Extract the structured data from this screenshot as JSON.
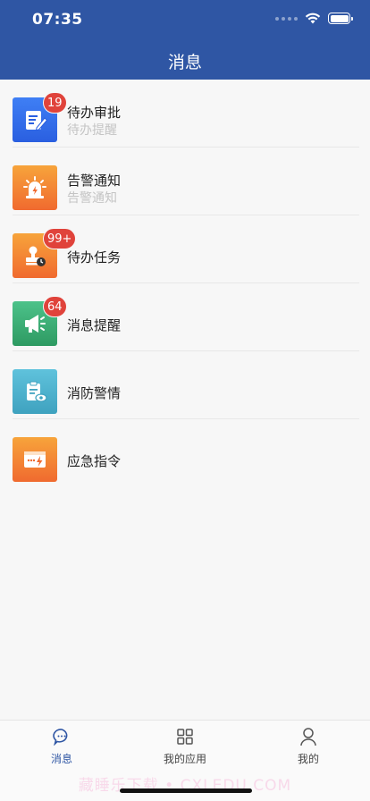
{
  "status_bar": {
    "time": "07:35"
  },
  "header": {
    "title": "消息"
  },
  "list": [
    {
      "title": "待办审批",
      "subtitle": "待办提醒",
      "badge": "19",
      "icon": "approval-document-icon",
      "color_top": "#3f7ff5",
      "color_bottom": "#2a5fe0"
    },
    {
      "title": "告警通知",
      "subtitle": "告警通知",
      "badge": "",
      "icon": "alarm-siren-icon",
      "color_top": "#f7a43b",
      "color_bottom": "#f06a2f"
    },
    {
      "title": "待办任务",
      "subtitle": "",
      "badge": "99+",
      "icon": "task-stamp-icon",
      "color_top": "#f7a43b",
      "color_bottom": "#f06a2f"
    },
    {
      "title": "消息提醒",
      "subtitle": "",
      "badge": "64",
      "icon": "megaphone-icon",
      "color_top": "#4cc28a",
      "color_bottom": "#2e9a62"
    },
    {
      "title": "消防警情",
      "subtitle": "",
      "badge": "",
      "icon": "fire-report-icon",
      "color_top": "#5fc2dc",
      "color_bottom": "#3fa2bf"
    },
    {
      "title": "应急指令",
      "subtitle": "",
      "badge": "",
      "icon": "emergency-command-icon",
      "color_top": "#f7a43b",
      "color_bottom": "#f06a2f"
    }
  ],
  "tabbar": {
    "tabs": [
      {
        "label": "消息",
        "icon": "chat-bubble-icon",
        "active": true
      },
      {
        "label": "我的应用",
        "icon": "grid-apps-icon",
        "active": false
      },
      {
        "label": "我的",
        "icon": "person-icon",
        "active": false
      }
    ]
  },
  "watermark": "藏睡乐下载 • CXLEDU.COM",
  "colors": {
    "header": "#2f56a4",
    "badge": "#e0433b",
    "active_tab": "#2f56a4"
  }
}
